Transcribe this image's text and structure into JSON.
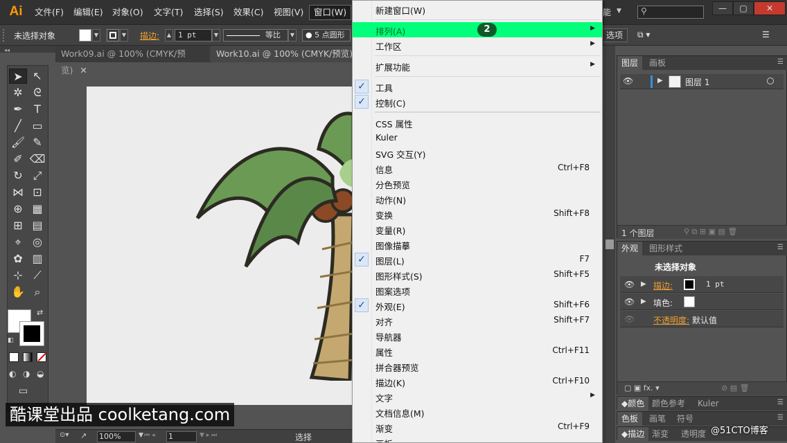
{
  "app": {
    "logo": "Ai",
    "menus": [
      "文件(F)",
      "编辑(E)",
      "对象(O)",
      "文字(T)",
      "选择(S)",
      "效果(C)",
      "视图(V)",
      "窗口(W)"
    ],
    "active_menu": "窗口(W)",
    "workspace_fragment": "能",
    "window_buttons": [
      "—",
      "▢",
      "✕"
    ]
  },
  "control": {
    "selection": "未选择对象",
    "stroke_label": "描边:",
    "stroke_value": "1 pt",
    "stroke_profile": "等比",
    "brush_label": "5 点圆形",
    "options_btn": "选项"
  },
  "doc_tabs": [
    {
      "label": "Work09.ai @ 100% (CMYK/预览)",
      "close": "✕"
    },
    {
      "label": "Work10.ai @ 100% (CMYK/预览)",
      "close": "✕"
    }
  ],
  "status": {
    "zoom": "100%",
    "page": "1",
    "tool": "选择"
  },
  "watermark": "酷课堂出品 coolketang.com",
  "blog_watermark": "@51CTO博客",
  "window_menu": {
    "highlight_badge": "2",
    "items": [
      {
        "label": "新建窗口(W)",
        "shortcut": "",
        "checked": false,
        "submenu": false
      },
      {
        "label": "排列(A)",
        "shortcut": "",
        "checked": false,
        "submenu": true,
        "highlight": true
      },
      {
        "label": "工作区",
        "shortcut": "",
        "checked": false,
        "submenu": true
      },
      {
        "label": "扩展功能",
        "shortcut": "",
        "checked": false,
        "submenu": true
      },
      {
        "label": "工具",
        "shortcut": "",
        "checked": true,
        "submenu": false
      },
      {
        "label": "控制(C)",
        "shortcut": "",
        "checked": true,
        "submenu": false
      },
      {
        "label": "CSS 属性",
        "shortcut": "",
        "checked": false,
        "submenu": false
      },
      {
        "label": "Kuler",
        "shortcut": "",
        "checked": false,
        "submenu": false
      },
      {
        "label": "SVG 交互(Y)",
        "shortcut": "",
        "checked": false,
        "submenu": false
      },
      {
        "label": "信息",
        "shortcut": "Ctrl+F8",
        "checked": false,
        "submenu": false
      },
      {
        "label": "分色预览",
        "shortcut": "",
        "checked": false,
        "submenu": false
      },
      {
        "label": "动作(N)",
        "shortcut": "",
        "checked": false,
        "submenu": false
      },
      {
        "label": "变换",
        "shortcut": "Shift+F8",
        "checked": false,
        "submenu": false
      },
      {
        "label": "变量(R)",
        "shortcut": "",
        "checked": false,
        "submenu": false
      },
      {
        "label": "图像描摹",
        "shortcut": "",
        "checked": false,
        "submenu": false
      },
      {
        "label": "图层(L)",
        "shortcut": "F7",
        "checked": true,
        "submenu": false
      },
      {
        "label": "图形样式(S)",
        "shortcut": "Shift+F5",
        "checked": false,
        "submenu": false
      },
      {
        "label": "图案选项",
        "shortcut": "",
        "checked": false,
        "submenu": false
      },
      {
        "label": "外观(E)",
        "shortcut": "Shift+F6",
        "checked": true,
        "submenu": false
      },
      {
        "label": "对齐",
        "shortcut": "Shift+F7",
        "checked": false,
        "submenu": false
      },
      {
        "label": "导航器",
        "shortcut": "",
        "checked": false,
        "submenu": false
      },
      {
        "label": "属性",
        "shortcut": "Ctrl+F11",
        "checked": false,
        "submenu": false
      },
      {
        "label": "拼合器预览",
        "shortcut": "",
        "checked": false,
        "submenu": false
      },
      {
        "label": "描边(K)",
        "shortcut": "Ctrl+F10",
        "checked": false,
        "submenu": false
      },
      {
        "label": "文字",
        "shortcut": "",
        "checked": false,
        "submenu": true
      },
      {
        "label": "文档信息(M)",
        "shortcut": "",
        "checked": false,
        "submenu": false
      },
      {
        "label": "渐变",
        "shortcut": "Ctrl+F9",
        "checked": false,
        "submenu": false
      },
      {
        "label": "画板",
        "shortcut": "",
        "checked": false,
        "submenu": false
      }
    ]
  },
  "layers_panel": {
    "tabs": [
      "图层",
      "画板"
    ],
    "layer_name": "图层 1",
    "footer": "1 个图层"
  },
  "appearance_panel": {
    "tabs": [
      "外观",
      "图形样式"
    ],
    "title": "未选择对象",
    "stroke_label": "描边:",
    "stroke_value": "1 pt",
    "fill_label": "填色:",
    "opacity_label": "不透明度:",
    "opacity_value": "默认值"
  },
  "bottom_panels": {
    "row1": [
      "颜色",
      "颜色参考",
      "Kuler"
    ],
    "row2": [
      "色板",
      "画笔",
      "符号"
    ],
    "row3": [
      "描边",
      "渐变",
      "透明度"
    ]
  },
  "colors": {
    "highlight": "#00ff7a",
    "accent_orange": "#f0a030",
    "ai_orange": "#ff9a00",
    "check_blue": "#1d4f9a"
  }
}
